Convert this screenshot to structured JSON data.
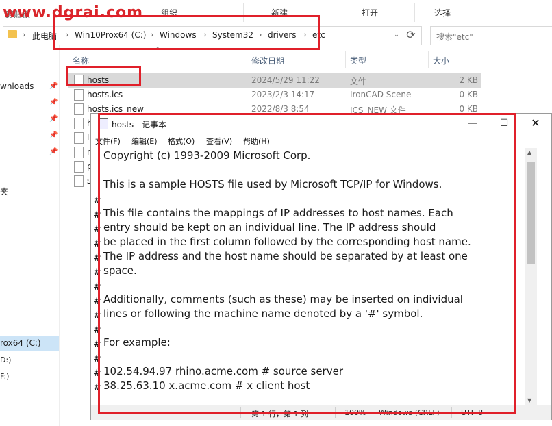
{
  "watermark": "www.dgrai.com",
  "ribbon": {
    "cut_label": "剪贴板",
    "organize": "组织",
    "new": "新建",
    "open": "打开",
    "select": "选择"
  },
  "address": {
    "segments": [
      "此电脑",
      "Win10Prox64 (C:)",
      "Windows",
      "System32",
      "drivers",
      "etc"
    ],
    "search_placeholder": "搜索\"etc\""
  },
  "sidebar": {
    "downloads": "wnloads",
    "desktop": "夹",
    "drive_c": "rox64 (C:)",
    "drive_d": "D:)",
    "drive_f": "F:)"
  },
  "columns": {
    "name": "名称",
    "date": "修改日期",
    "type": "类型",
    "size": "大小"
  },
  "files": [
    {
      "name": "hosts",
      "date": "2024/5/29 11:22",
      "type": "文件",
      "size": "2 KB"
    },
    {
      "name": "hosts.ics",
      "date": "2023/2/3 14:17",
      "type": "IronCAD Scene",
      "size": "0 KB"
    },
    {
      "name": "hosts.ics_new",
      "date": "2022/8/3 8:54",
      "type": "ICS_NEW 文件",
      "size": "0 KB"
    }
  ],
  "hidden_file_initials": [
    "h",
    "l",
    "n",
    "p",
    "s"
  ],
  "notepad": {
    "title": "hosts - 记事本",
    "menu": [
      "文件(F)",
      "编辑(E)",
      "格式(O)",
      "查看(V)",
      "帮助(H)"
    ],
    "lines": [
      "Copyright (c) 1993-2009 Microsoft Corp.",
      "",
      "This is a sample HOSTS file used by Microsoft TCP/IP for Windows.",
      "",
      "This file contains the mappings of IP addresses to host names. Each",
      "entry should be kept on an individual line. The IP address should",
      "be placed in the first column followed by the corresponding host name.",
      "The IP address and the host name should be separated by at least one",
      "space.",
      "",
      "Additionally, comments (such as these) may be inserted on individual",
      "lines or following the machine name denoted by a '#' symbol.",
      "",
      "For example:",
      "",
      "102.54.94.97 rhino.acme.com # source server",
      "38.25.63.10 x.acme.com # x client host"
    ],
    "hash_mark": "#",
    "status": {
      "position": "第 1 行，第 1 列",
      "zoom": "100%",
      "eol": "Windows (CRLF)",
      "encoding": "UTF-8"
    }
  },
  "colors": {
    "annotation": "#e0202a",
    "selected_row": "#d9d9d9",
    "nav_selected": "#cce4f7"
  }
}
